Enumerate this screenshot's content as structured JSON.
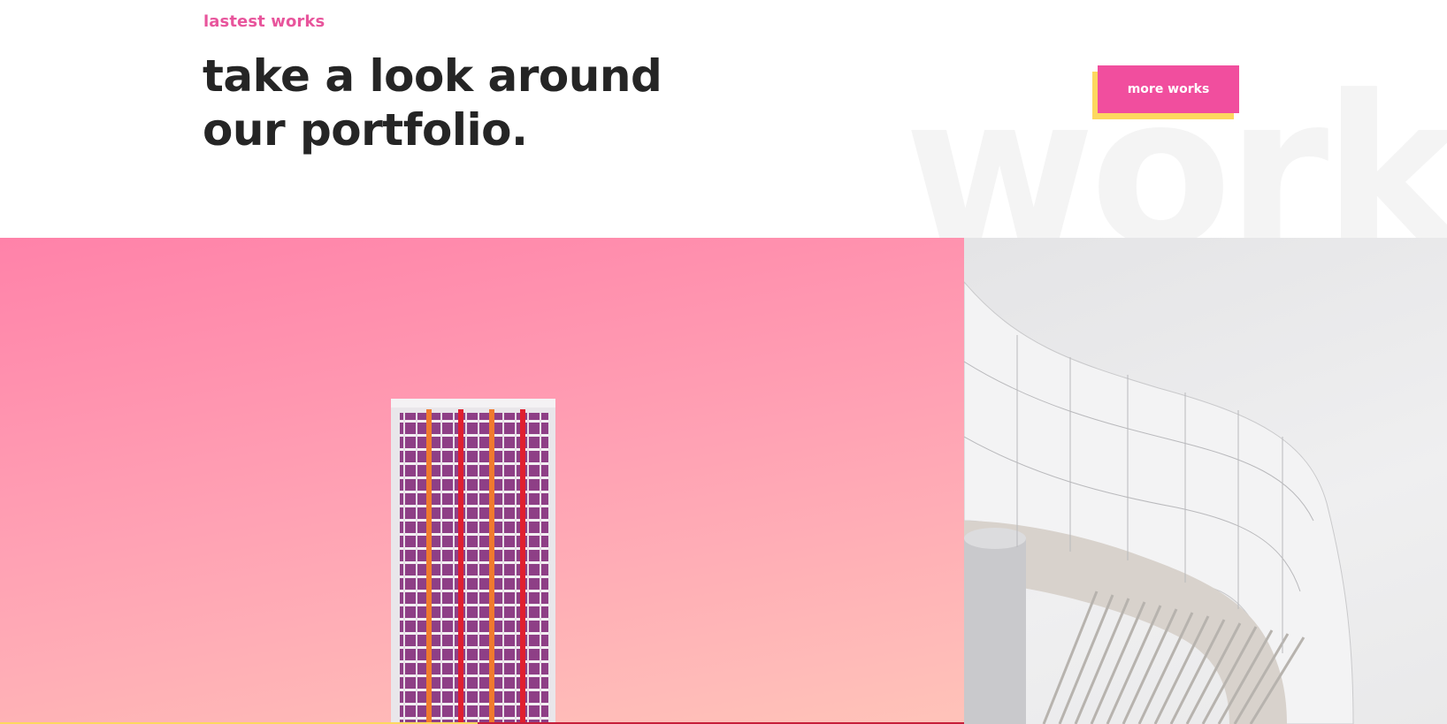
{
  "section": {
    "eyebrow": "lastest works",
    "headline_line1": "take a look around",
    "headline_line2": "our portfolio.",
    "background_word": "works",
    "button_label": "more works"
  },
  "colors": {
    "accent_pink": "#f14e9e",
    "accent_yellow": "#fdd85f",
    "heading": "#252525"
  },
  "gallery": {
    "items": [
      {
        "name": "pink-tower-photo",
        "kind": "image"
      },
      {
        "name": "white-curved-building-photo",
        "kind": "image"
      }
    ]
  }
}
